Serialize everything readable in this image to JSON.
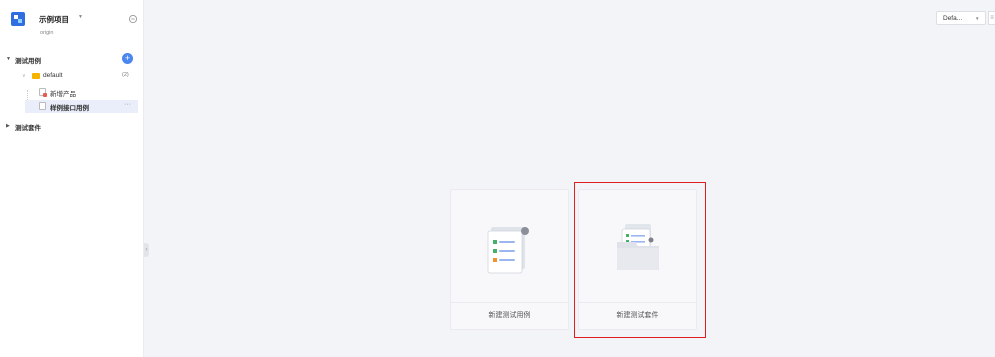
{
  "project": {
    "name": "示例项目",
    "branch": "origin"
  },
  "tree": {
    "test_cases": "测试用例",
    "folder": {
      "name": "default",
      "count": "(2)"
    },
    "items": [
      "新增产品",
      "样例接口用例"
    ],
    "test_suites": "测试套件"
  },
  "toolbar": {
    "env": "Defa..."
  },
  "cards": [
    {
      "label": "新建测试用例"
    },
    {
      "label": "新建测试套件"
    }
  ],
  "colors": {
    "accent": "#4a86f0",
    "highlight": "#e02020",
    "folder": "#f5b400"
  }
}
